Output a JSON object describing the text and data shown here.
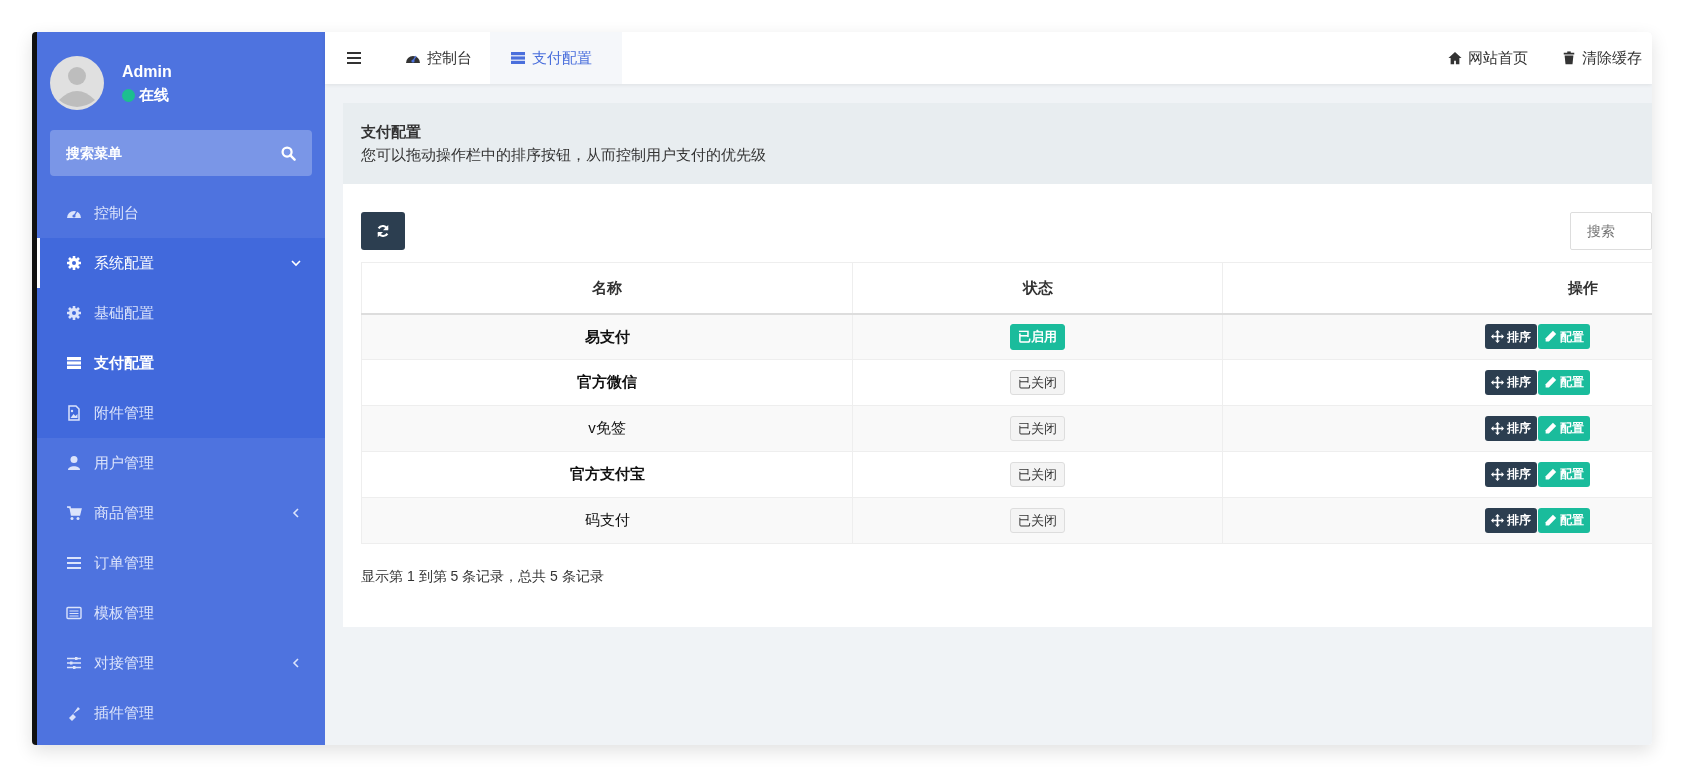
{
  "user": {
    "name": "Admin",
    "status": "在线",
    "online": true
  },
  "sidebar": {
    "search_placeholder": "搜索菜单",
    "items": [
      {
        "label": "控制台",
        "selected": false
      },
      {
        "label": "系统配置",
        "selected": false,
        "expanded": true,
        "children": [
          {
            "label": "基础配置",
            "selected": false
          },
          {
            "label": "支付配置",
            "selected": true
          },
          {
            "label": "附件管理",
            "selected": false
          }
        ]
      },
      {
        "label": "用户管理",
        "selected": false
      },
      {
        "label": "商品管理",
        "selected": false,
        "expanded": false
      },
      {
        "label": "订单管理",
        "selected": false
      },
      {
        "label": "模板管理",
        "selected": false
      },
      {
        "label": "对接管理",
        "selected": false,
        "expanded": false
      },
      {
        "label": "插件管理",
        "selected": false
      }
    ]
  },
  "topbar": {
    "tabs": [
      {
        "label": "控制台",
        "selected": false
      },
      {
        "label": "支付配置",
        "selected": true
      }
    ],
    "links": [
      "网站首页",
      "清除缓存"
    ]
  },
  "panel": {
    "title": "支付配置",
    "description": "您可以拖动操作栏中的排序按钮，从而控制用户支付的优先级"
  },
  "toolbar": {
    "search_placeholder": "搜索"
  },
  "table": {
    "columns": [
      "名称",
      "状态",
      "操作"
    ],
    "rows": [
      {
        "name": "易支付",
        "bold": true,
        "status": "已启用",
        "enabled": true,
        "actions": [
          "排序",
          "配置"
        ]
      },
      {
        "name": "官方微信",
        "bold": true,
        "status": "已关闭",
        "enabled": false,
        "actions": [
          "排序",
          "配置"
        ]
      },
      {
        "name": "v免签",
        "bold": false,
        "status": "已关闭",
        "enabled": false,
        "actions": [
          "排序",
          "配置"
        ]
      },
      {
        "name": "官方支付宝",
        "bold": true,
        "status": "已关闭",
        "enabled": false,
        "actions": [
          "排序",
          "配置"
        ]
      },
      {
        "name": "码支付",
        "bold": false,
        "status": "已关闭",
        "enabled": false,
        "actions": [
          "排序",
          "配置"
        ]
      }
    ]
  },
  "footer": "显示第 1 到第 5 条记录，总共 5 条记录"
}
